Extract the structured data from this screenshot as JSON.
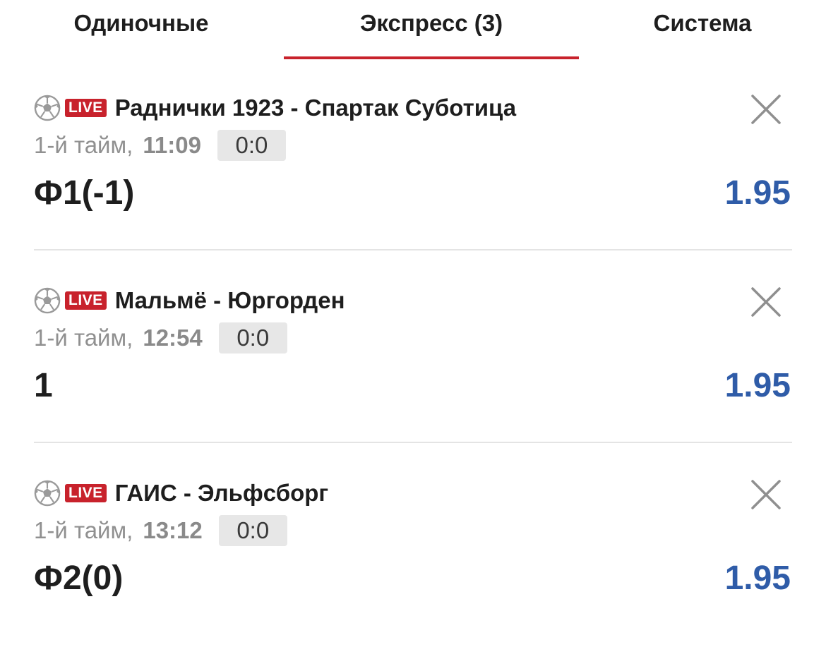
{
  "tabs": [
    {
      "label": "Одиночные",
      "active": false
    },
    {
      "label": "Экспресс (3)",
      "active": true
    },
    {
      "label": "Система",
      "active": false
    }
  ],
  "colors": {
    "accent_red": "#c8222c",
    "odds_blue": "#2f5ca8"
  },
  "bets": [
    {
      "sport_icon": "soccer-ball-icon",
      "live_label": "LIVE",
      "match": "Раднички 1923 - Спартак Суботица",
      "period": "1-й тайм,",
      "clock": "11:09",
      "score": "0:0",
      "outcome": "Ф1(-1)",
      "odds": "1.95"
    },
    {
      "sport_icon": "soccer-ball-icon",
      "live_label": "LIVE",
      "match": "Мальмё - Юргорден",
      "period": "1-й тайм,",
      "clock": "12:54",
      "score": "0:0",
      "outcome": "1",
      "odds": "1.95"
    },
    {
      "sport_icon": "soccer-ball-icon",
      "live_label": "LIVE",
      "match": "ГАИС - Эльфсборг",
      "period": "1-й тайм,",
      "clock": "13:12",
      "score": "0:0",
      "outcome": "Ф2(0)",
      "odds": "1.95"
    }
  ]
}
